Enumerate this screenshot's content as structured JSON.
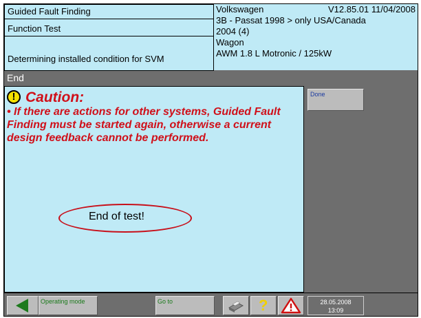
{
  "header": {
    "left": {
      "title": "Guided Fault Finding",
      "subtitle": "Function Test",
      "step": "Determining installed condition for SVM"
    },
    "vehicle": {
      "make": "Volkswagen",
      "version": "V12.85.01 11/04/2008",
      "model": "3B - Passat 1998 > only USA/Canada",
      "year": "2004 (4)",
      "body": "Wagon",
      "engine": "AWM 1.8 L Motronic / 125kW"
    }
  },
  "status_bar": {
    "label": "End"
  },
  "main": {
    "caution_icon": "exclamation-circle-icon",
    "caution_title": "Caution:",
    "caution_text": "• If there are actions for other systems, Guided Fault Finding must be started again, otherwise a current design feedback cannot be performed.",
    "end_text": "End of test!"
  },
  "side": {
    "done_label": "Done"
  },
  "footer": {
    "operating_mode_label": "Operating mode",
    "goto_label": "Go to",
    "help_symbol": "?",
    "date": "28.05.2008",
    "time": "13:09",
    "icons": {
      "back": "arrow-left-icon",
      "print": "printer-icon",
      "help": "question-mark-icon",
      "warning": "warning-triangle-icon"
    }
  },
  "colors": {
    "panel": "#bfeaf6",
    "frame": "#6e6e6e",
    "caution_red": "#d0101a",
    "caution_yellow": "#f4e200",
    "oval": "#c8101a",
    "back_arrow": "#1d7a1d"
  }
}
